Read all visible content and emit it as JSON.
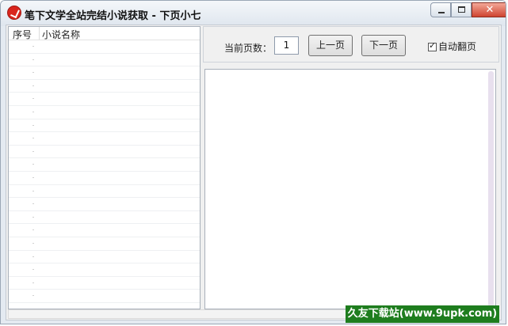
{
  "window": {
    "title": "笔下文学全站完结小说获取 - 下页小七"
  },
  "list": {
    "columns": [
      "序号",
      "小说名称"
    ],
    "rows": []
  },
  "controls": {
    "page_label": "当前页数：",
    "page_value": "1",
    "prev_label": "上一页",
    "next_label": "下一页",
    "auto_flip_label": "自动翻页",
    "auto_flip_checked": true
  },
  "watermark": {
    "text": "久友下载站(www.9upk.com)"
  },
  "colors": {
    "close_button": "#cf4430",
    "watermark_bg": "#1e7d1e"
  }
}
